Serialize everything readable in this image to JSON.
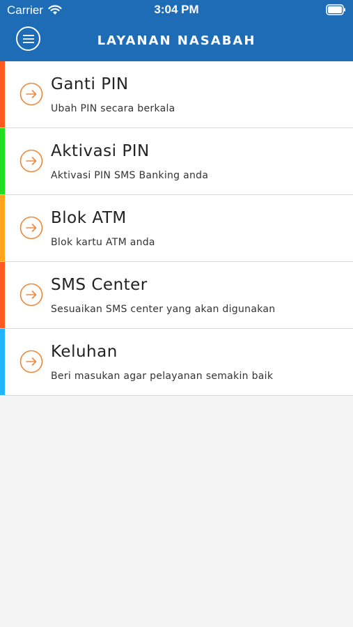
{
  "status_bar": {
    "carrier": "Carrier",
    "time": "3:04 PM"
  },
  "header": {
    "title": "LAYANAN NASABAH",
    "background_color": "#1e6cb5",
    "menu_icon": "hamburger-menu-icon"
  },
  "items": [
    {
      "title": "Ganti PIN",
      "subtitle": "Ubah PIN secara berkala",
      "accent_color": "#ff5a1f",
      "icon": "arrow-right-circle-icon"
    },
    {
      "title": "Aktivasi PIN",
      "subtitle": "Aktivasi PIN SMS Banking anda",
      "accent_color": "#22dd22",
      "icon": "arrow-right-circle-icon"
    },
    {
      "title": "Blok ATM",
      "subtitle": "Blok kartu ATM anda",
      "accent_color": "#ffa51f",
      "icon": "arrow-right-circle-icon"
    },
    {
      "title": "SMS Center",
      "subtitle": "Sesuaikan SMS center yang akan digunakan",
      "accent_color": "#ff5a1f",
      "icon": "arrow-right-circle-icon"
    },
    {
      "title": "Keluhan",
      "subtitle": "Beri masukan agar pelayanan semakin baik",
      "accent_color": "#1fb6ff",
      "icon": "arrow-right-circle-icon"
    }
  ],
  "icon_color": "#f0883a"
}
